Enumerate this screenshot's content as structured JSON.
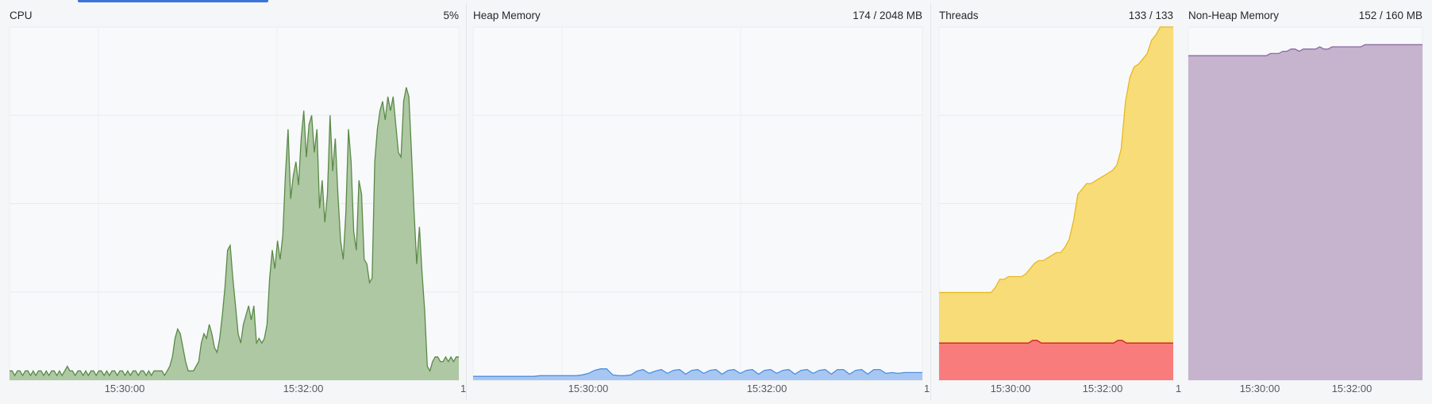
{
  "panels": [
    {
      "id": "cpu",
      "title": "CPU",
      "value": "5%",
      "x_ticks": [
        "15:30:00",
        "15:32:00"
      ],
      "end_mark": "1",
      "colors": {
        "line": "#5a8a47",
        "fill": "#adc8a2"
      }
    },
    {
      "id": "heap",
      "title": "Heap Memory",
      "value": "174 / 2048 MB",
      "x_ticks": [
        "15:30:00",
        "15:32:00"
      ],
      "end_mark": "1",
      "colors": {
        "line": "#4d8fe0",
        "fill": "#a7c7f2"
      }
    },
    {
      "id": "threads",
      "title": "Threads",
      "value": "133 / 133",
      "x_ticks": [
        "15:30:00",
        "15:32:00"
      ],
      "end_mark": "1",
      "colors": {
        "line": "#e8b820",
        "fill": "#f8dc78",
        "line2": "#cc2222",
        "fill2": "#f97c7c"
      }
    },
    {
      "id": "nonheap",
      "title": "Non-Heap Memory",
      "value": "152 / 160 MB",
      "x_ticks": [
        "15:30:00",
        "15:32:00"
      ],
      "end_mark": "",
      "colors": {
        "line": "#8c6aa3",
        "fill": "#c6b3ce"
      }
    }
  ],
  "chart_data": [
    {
      "type": "area",
      "title": "CPU",
      "x_ticks": [
        "15:30:00",
        "15:32:00"
      ],
      "series": [
        {
          "values": [
            2,
            2,
            1,
            2,
            2,
            1,
            2,
            2,
            1,
            2,
            1,
            2,
            2,
            1,
            2,
            1,
            2,
            2,
            1,
            2,
            1,
            2,
            3,
            2,
            2,
            1,
            2,
            2,
            1,
            2,
            1,
            2,
            2,
            1,
            2,
            2,
            1,
            2,
            1,
            2,
            2,
            1,
            2,
            2,
            1,
            2,
            1,
            2,
            2,
            1,
            2,
            2,
            1,
            2,
            1,
            2,
            2,
            2,
            2,
            1,
            2,
            3,
            5,
            9,
            11,
            10,
            7,
            4,
            2,
            2,
            2,
            3,
            4,
            8,
            10,
            9,
            12,
            10,
            7,
            6,
            9,
            14,
            20,
            28,
            29,
            22,
            16,
            10,
            8,
            12,
            14,
            16,
            13,
            16,
            8,
            9,
            8,
            9,
            12,
            22,
            28,
            24,
            30,
            26,
            31,
            44,
            54,
            39,
            44,
            47,
            42,
            52,
            58,
            48,
            55,
            57,
            49,
            54,
            37,
            43,
            34,
            40,
            57,
            45,
            52,
            40,
            30,
            26,
            36,
            54,
            47,
            32,
            28,
            43,
            40,
            26,
            25,
            21,
            22,
            47,
            54,
            58,
            60,
            56,
            61,
            58,
            61,
            55,
            49,
            48,
            60,
            63,
            61,
            49,
            36,
            25,
            33,
            23,
            15,
            3,
            2,
            4,
            5,
            5,
            4,
            4,
            5,
            4,
            5,
            4,
            5,
            5
          ]
        }
      ]
    },
    {
      "type": "area",
      "title": "Heap Memory",
      "x_ticks": [
        "15:30:00",
        "15:32:00"
      ],
      "series": [
        {
          "values": [
            5,
            5,
            5,
            5,
            5,
            5,
            5,
            5,
            5,
            5,
            5,
            6,
            6,
            6,
            6,
            6,
            6,
            6,
            7,
            9,
            13,
            15,
            15,
            7,
            6,
            6,
            7,
            12,
            14,
            9,
            12,
            14,
            9,
            13,
            14,
            8,
            13,
            14,
            9,
            13,
            14,
            8,
            13,
            14,
            9,
            13,
            14,
            8,
            13,
            14,
            9,
            13,
            14,
            8,
            13,
            14,
            9,
            13,
            14,
            8,
            14,
            14,
            8,
            13,
            14,
            8,
            14,
            14,
            9,
            10,
            9,
            10,
            10,
            10,
            10
          ]
        }
      ]
    },
    {
      "type": "area",
      "title": "Threads",
      "x_ticks": [
        "15:30:00",
        "15:32:00"
      ],
      "series": [
        {
          "values": [
            33,
            33,
            33,
            33,
            33,
            33,
            33,
            33,
            33,
            33,
            33,
            33,
            33,
            35,
            38,
            38,
            39,
            39,
            39,
            39,
            40,
            42,
            44,
            45,
            45,
            46,
            47,
            48,
            48,
            50,
            53,
            60,
            70,
            72,
            74,
            74,
            75,
            76,
            77,
            78,
            79,
            81,
            87,
            105,
            114,
            118,
            119,
            121,
            123,
            128,
            130,
            133,
            133,
            133,
            133
          ]
        },
        {
          "values": [
            14,
            14,
            14,
            14,
            14,
            14,
            14,
            14,
            14,
            14,
            14,
            14,
            14,
            14,
            14,
            14,
            14,
            14,
            14,
            14,
            14,
            14,
            15,
            15,
            14,
            14,
            14,
            14,
            14,
            14,
            14,
            14,
            14,
            14,
            14,
            14,
            14,
            14,
            14,
            14,
            14,
            14,
            15,
            15,
            14,
            14,
            14,
            14,
            14,
            14,
            14,
            14,
            14,
            14,
            14,
            14
          ]
        }
      ]
    },
    {
      "type": "area",
      "title": "Non-Heap Memory",
      "x_ticks": [
        "15:30:00",
        "15:32:00"
      ],
      "series": [
        {
          "values": [
            147,
            147,
            147,
            147,
            147,
            147,
            147,
            147,
            147,
            147,
            147,
            147,
            147,
            147,
            147,
            147,
            147,
            147,
            147,
            147,
            148,
            148,
            148,
            149,
            149,
            150,
            150,
            149,
            150,
            150,
            150,
            150,
            151,
            150,
            150,
            151,
            151,
            151,
            151,
            151,
            151,
            151,
            151,
            152,
            152,
            152,
            152,
            152,
            152,
            152,
            152,
            152,
            152,
            152,
            152,
            152,
            152,
            152
          ]
        }
      ]
    }
  ]
}
